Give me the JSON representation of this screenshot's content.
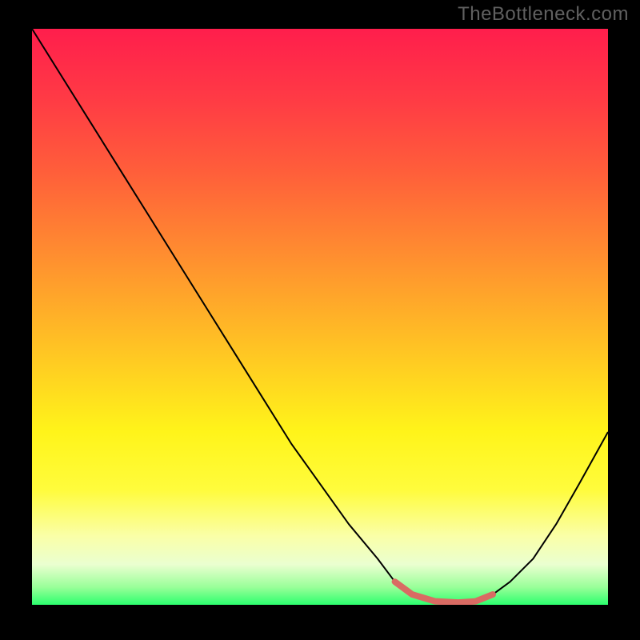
{
  "watermark": "TheBottleneck.com",
  "chart_data": {
    "type": "line",
    "title": "",
    "xlabel": "",
    "ylabel": "",
    "xlim": [
      0,
      100
    ],
    "ylim": [
      0,
      100
    ],
    "grid": false,
    "legend": false,
    "background_gradient": {
      "stops": [
        {
          "offset": 0.0,
          "color": "#ff1e4c"
        },
        {
          "offset": 0.12,
          "color": "#ff3a45"
        },
        {
          "offset": 0.25,
          "color": "#ff5f3a"
        },
        {
          "offset": 0.4,
          "color": "#ff902f"
        },
        {
          "offset": 0.55,
          "color": "#ffc224"
        },
        {
          "offset": 0.7,
          "color": "#fff41a"
        },
        {
          "offset": 0.8,
          "color": "#fffc3c"
        },
        {
          "offset": 0.88,
          "color": "#faffa7"
        },
        {
          "offset": 0.93,
          "color": "#eaffd0"
        },
        {
          "offset": 0.97,
          "color": "#98ff98"
        },
        {
          "offset": 1.0,
          "color": "#2cff6e"
        }
      ]
    },
    "series": [
      {
        "name": "bottleneck-curve",
        "stroke": "#000000",
        "stroke_width": 2,
        "x": [
          0.0,
          5,
          10,
          15,
          20,
          25,
          30,
          35,
          40,
          45,
          50,
          55,
          60,
          63,
          66,
          70,
          74,
          77,
          80,
          83,
          87,
          91,
          95,
          100
        ],
        "y": [
          100,
          92,
          84,
          76,
          68,
          60,
          52,
          44,
          36,
          28,
          21,
          14,
          8,
          4,
          1.8,
          0.6,
          0.4,
          0.6,
          1.8,
          4,
          8,
          14,
          21,
          30
        ]
      }
    ],
    "overlay_segments": [
      {
        "name": "highlight-segment",
        "stroke": "#d96b63",
        "stroke_width": 8,
        "linecap": "round",
        "x": [
          63,
          66,
          70,
          74,
          77,
          80
        ],
        "y": [
          4,
          1.8,
          0.6,
          0.4,
          0.6,
          1.8
        ]
      }
    ]
  }
}
